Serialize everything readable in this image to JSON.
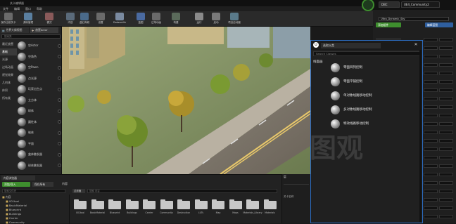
{
  "window": {
    "title": "关卡编辑器"
  },
  "menu": [
    "文件",
    "编辑",
    "窗口",
    "帮助"
  ],
  "toolbar": {
    "buttons": [
      {
        "label": "保存当前关卡",
        "icon": "save-icon",
        "color": "#6a6a6a"
      },
      {
        "label": "源码管理",
        "icon": "source-control-icon",
        "color": "#5a7fa0"
      },
      {
        "label": "模式",
        "icon": "modes-icon",
        "color": "#8a5a5a"
      },
      {
        "label": "内容",
        "icon": "content-icon",
        "color": "#5a6a7a"
      },
      {
        "label": "虚幻商城",
        "icon": "marketplace-icon",
        "color": "#4a6a8a"
      },
      {
        "label": "设置",
        "icon": "settings-icon",
        "color": "#6a6a6a"
      },
      {
        "label": "Datasmith",
        "icon": "datasmith-icon",
        "color": "#7a8aa0"
      },
      {
        "label": "蓝图",
        "icon": "blueprints-icon",
        "color": "#4a6aa0"
      },
      {
        "label": "过场动画",
        "icon": "cinematics-icon",
        "color": "#6a6a6a"
      },
      {
        "label": "构建",
        "icon": "build-icon",
        "color": "#5a6a5a"
      },
      {
        "label": "运行",
        "icon": "play-icon",
        "color": "#8a8a8a"
      },
      {
        "label": "启动",
        "icon": "launch-icon",
        "color": "#7a7a7a"
      },
      {
        "label": "项目启动器",
        "icon": "project-launcher-icon",
        "color": "#5a7a8a"
      }
    ]
  },
  "tabs_right": [
    "DBC",
    "UE4_Community2"
  ],
  "left_panel": {
    "tabs": [
      "世界大纲视图",
      "放置Actor"
    ],
    "search_placeholder": "搜索类",
    "categories": [
      "最近放置",
      "基础",
      "光源",
      "过场动画",
      "视觉效果",
      "几何体",
      "体积",
      "所有类"
    ],
    "items": [
      "空Actor",
      "空角色",
      "空Pawn",
      "点光源",
      "玩家出生点",
      "立方体",
      "球体",
      "圆柱体",
      "锥体",
      "平面",
      "盒体触发器",
      "球体触发器"
    ]
  },
  "dialog": {
    "title": "选取父类",
    "search_placeholder": "Search Classes",
    "category": "线面画",
    "items": [
      "零面目列控制",
      "零面平铺控制",
      "单对象线路移动控制",
      "多对象线路移动控制",
      "特效线路移动控制"
    ]
  },
  "content_browser": {
    "tab": "内容浏览器",
    "add_button": "添加/导入",
    "save_all": "保存所有",
    "path": "内容",
    "filters_label": "过滤器",
    "search_placeholder": "搜索 内容",
    "tree_search": "搜索文件夹",
    "tree": [
      "内容",
      "001tool",
      "BasicMaterial",
      "Blueprint",
      "Buildings",
      "Carrier",
      "Community"
    ],
    "folders": [
      "001tool",
      "BasicMaterial",
      "Blueprint",
      "Buildings",
      "Carrier",
      "Community",
      "Destruction",
      "LUTs",
      "Map",
      "Maps",
      "Materials_Library",
      "Materials"
    ]
  },
  "right_panel": {
    "search_value": "Ultra_Dynamic_Sky",
    "add_component": "添加组件",
    "edit_blueprint": "编辑蓝图"
  },
  "right_bottom": {
    "tab": "层",
    "label": "关卡名称"
  },
  "watermark": "图观",
  "colors": {
    "accent": "#2b6bbf",
    "green": "#3e8e2e"
  }
}
